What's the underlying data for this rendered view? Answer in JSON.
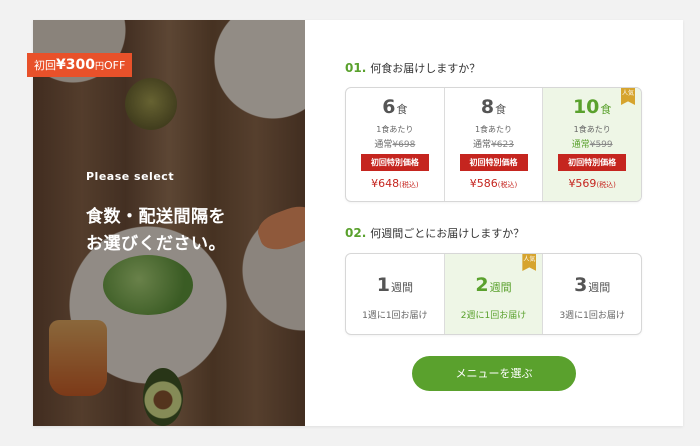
{
  "promo": {
    "prefix": "初回",
    "amount": "¥300",
    "unit": "円",
    "suffix": "OFF"
  },
  "hero": {
    "subtitle": "Please select",
    "headline_line1": "食数・配送間隔を",
    "headline_line2": "お選びください。"
  },
  "q1": {
    "num": "01.",
    "text": "何食お届けしますか？"
  },
  "meal_options": [
    {
      "count": "6",
      "unit": "食",
      "per_label": "1食あたり",
      "regular_label": "通常",
      "regular_price": "¥698",
      "special_label": "初回特別価格",
      "price": "¥648",
      "tax": "(税込)",
      "selected": false
    },
    {
      "count": "8",
      "unit": "食",
      "per_label": "1食あたり",
      "regular_label": "通常",
      "regular_price": "¥623",
      "special_label": "初回特別価格",
      "price": "¥586",
      "tax": "(税込)",
      "selected": false
    },
    {
      "count": "10",
      "unit": "食",
      "per_label": "1食あたり",
      "regular_label": "通常",
      "regular_price": "¥599",
      "special_label": "初回特別価格",
      "price": "¥569",
      "tax": "(税込)",
      "selected": true
    }
  ],
  "q2": {
    "num": "02.",
    "text": "何週間ごとにお届けしますか？"
  },
  "week_options": [
    {
      "count": "1",
      "unit": "週間",
      "desc": "1週に1回お届け",
      "selected": false
    },
    {
      "count": "2",
      "unit": "週間",
      "desc": "2週に1回お届け",
      "selected": true
    },
    {
      "count": "3",
      "unit": "週間",
      "desc": "3週に1回お届け",
      "selected": false
    }
  ],
  "ribbon_label": "人気",
  "cta_label": "メニューを選ぶ",
  "colors": {
    "accent": "#5aa12d",
    "red": "#c5251f",
    "promo": "#e8512a",
    "ribbon": "#d6a42e"
  }
}
